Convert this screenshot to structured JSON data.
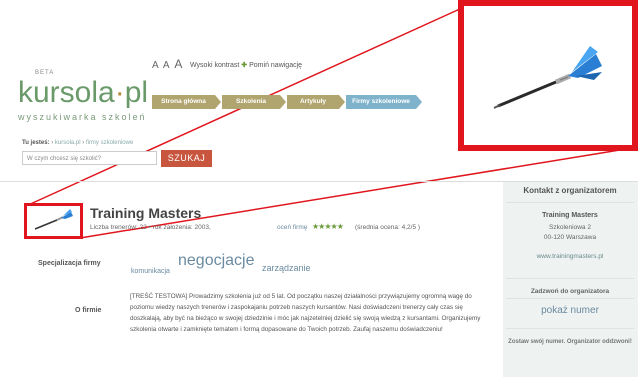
{
  "logo": {
    "beta": "BETA",
    "brand_main": "kursola",
    "brand_dot": "·",
    "brand_tld": "pl",
    "tagline": "wyszukiwarka szkoleń"
  },
  "accessibility": {
    "sizes": [
      "A",
      "A",
      "A"
    ],
    "contrast": "Wysoki kontrast",
    "skip": "Pomiń nawigację"
  },
  "nav": {
    "tabs": [
      {
        "label": "Strona główna",
        "color": "#b1a56f"
      },
      {
        "label": "Szkolenia",
        "color": "#b1a56f"
      },
      {
        "label": "Artykuły",
        "color": "#b1a56f"
      },
      {
        "label": "Firmy szkoleniowe",
        "color": "#7fb3cc"
      }
    ]
  },
  "breadcrumb": {
    "prefix": "Tu jesteś:",
    "items": [
      "kursola.pl",
      "firmy szkoleniowe"
    ]
  },
  "search": {
    "placeholder": "W czym chcesz się szkolić?",
    "button": "SZUKAJ"
  },
  "company": {
    "name": "Training Masters",
    "meta": "Liczba trenerów: 22 • rok założenia: 2003,",
    "rate_link": "oceń firmę",
    "stars": "★★★★★",
    "rating": "(średnia ocena: 4,2/5 )"
  },
  "specialization": {
    "label": "Specjalizacja firmy",
    "tags": [
      "komunikacja",
      "negocjacje",
      "zarządzanie"
    ]
  },
  "about": {
    "label": "O firmie",
    "text": "[TREŚĆ TESTOWA] Prowadzimy szkolenia już od 5 lat. Od początku naszej działalności przywiązujemy ogromną wagę do poziomu wiedzy naszych trenerów i zaspokajaniu potrzeb naszych kursantów. Nasi doświadczeni trenerzy cały czas się doszkalają, aby być na bieżąco w swojej dziedzinie i móc jak najzetelniej dzielić się swoją wiedzą z kursantami. Organizujemy szkolenia otwarte i zamknięte tematem i formą dopasowane do Twoich potrzeb. Zaufaj naszemu doświadczeniu!"
  },
  "contact": {
    "title": "Kontakt z organizatorem",
    "name": "Training Masters",
    "street": "Szkoleniowa 2",
    "city": "00-120 Warszawa",
    "website": "www.trainingmasters.pl",
    "call_label": "Zadzwoń do organizatora",
    "show_number": "pokaż numer",
    "leave_number": "Zostaw swój numer. Organizator oddzwoni!"
  },
  "colors": {
    "accent_red": "#e0151d",
    "search_btn": "#c8553e",
    "link": "#6a8aa0",
    "star": "#6a9a3a"
  },
  "icons": {
    "logo_image": "dart-icon"
  }
}
